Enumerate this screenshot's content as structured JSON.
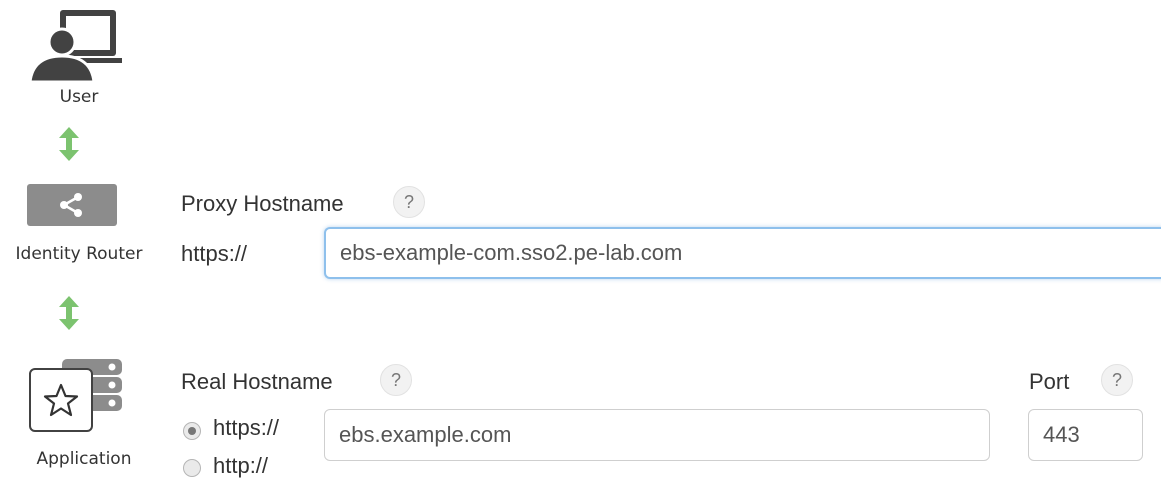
{
  "flow": {
    "user_label": "User",
    "router_label": "Identity Router",
    "application_label": "Application"
  },
  "proxy": {
    "label": "Proxy Hostname",
    "help": "?",
    "scheme": "https://",
    "hostname": "ebs-example-com.sso2.pe-lab.com"
  },
  "real": {
    "label": "Real Hostname",
    "help": "?",
    "scheme_options": [
      "https://",
      "http://"
    ],
    "selected_scheme": "https://",
    "hostname": "ebs.example.com"
  },
  "port": {
    "label": "Port",
    "help": "?",
    "value": "443"
  },
  "colors": {
    "arrow": "#7cc36f",
    "focus_border": "#8ec0ec",
    "icon_dark": "#424242",
    "router_bg": "#8c8c8c"
  }
}
